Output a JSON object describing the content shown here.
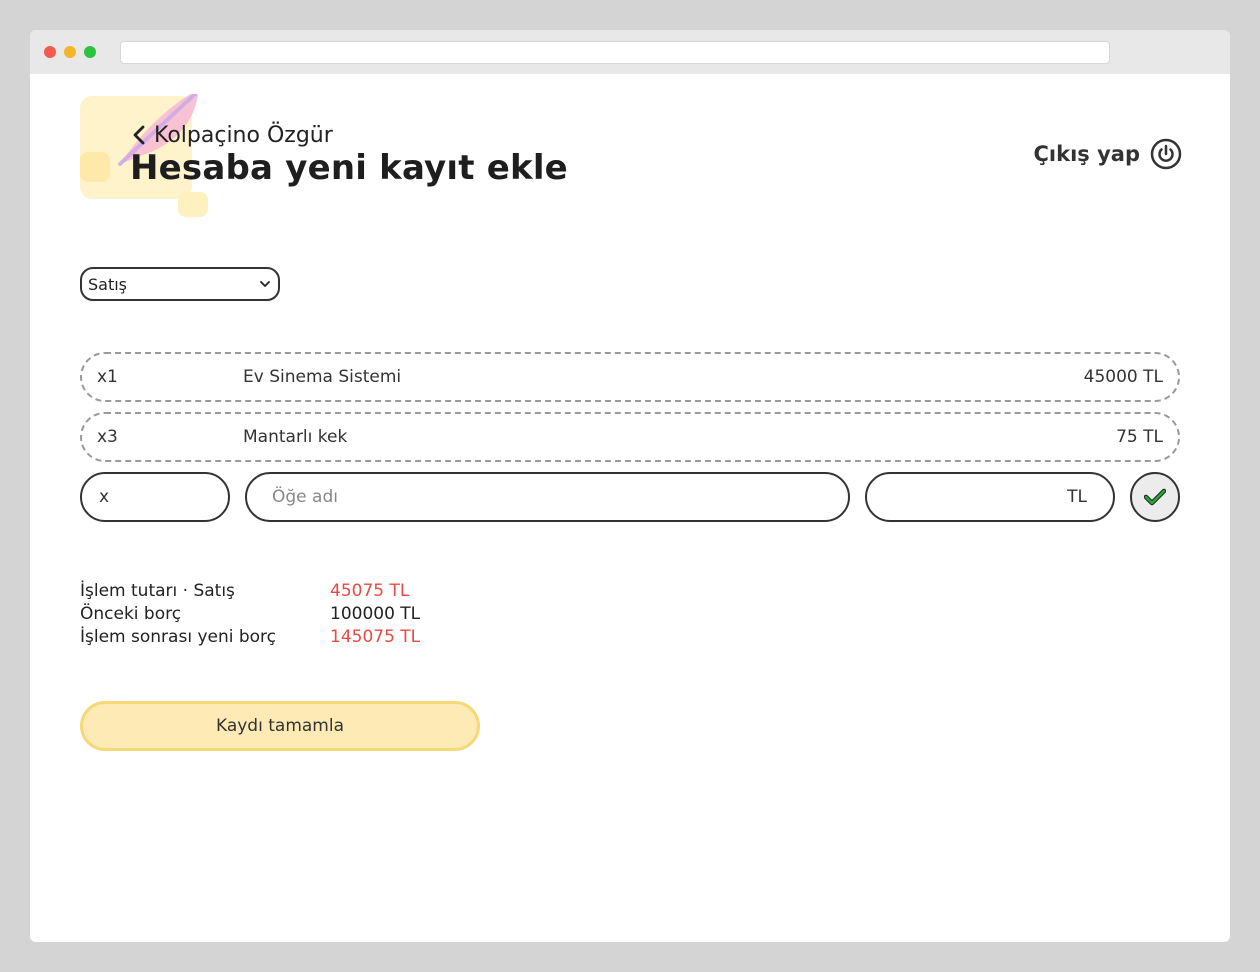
{
  "header": {
    "back_label": "Kolpaçino Özgür",
    "title": "Hesaba yeni kayıt ekle",
    "logout_label": "Çıkış yap"
  },
  "form": {
    "transaction_type": "Satış"
  },
  "items": [
    {
      "qty": "x1",
      "name": "Ev Sinema Sistemi",
      "price": "45000 TL"
    },
    {
      "qty": "x3",
      "name": "Mantarlı kek",
      "price": "75 TL"
    }
  ],
  "entry": {
    "qty_prefix": "x",
    "name_placeholder": "Öğe adı",
    "price_suffix": "TL"
  },
  "summary": {
    "rows": [
      {
        "label": "İşlem tutarı · Satış",
        "value": "45075 TL",
        "color": "#e84a45"
      },
      {
        "label": "Önceki borç",
        "value": "100000 TL",
        "color": "#222222"
      },
      {
        "label": "İşlem sonrası yeni borç",
        "value": "145075 TL",
        "color": "#e84a45"
      }
    ]
  },
  "actions": {
    "complete_label": "Kaydı tamamla"
  },
  "colors": {
    "accent_fill": "#feeab4",
    "accent_border": "#f7d878",
    "negative": "#e84a45",
    "check_green": "#1fae2e"
  },
  "icons": {
    "back": "chevron-left-icon",
    "logout": "power-icon",
    "confirm": "check-icon",
    "logo": "scroll-feather-logo"
  }
}
